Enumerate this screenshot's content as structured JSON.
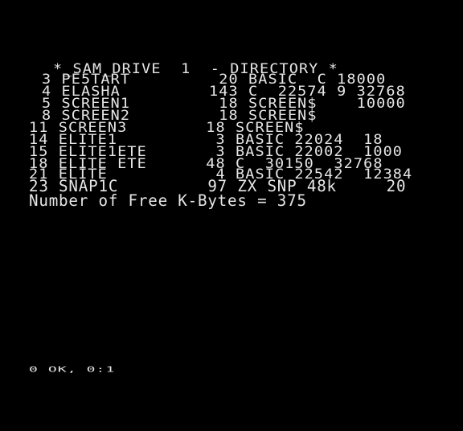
{
  "title": "*_SAM_DRIVE  1  - DIRECTORY *",
  "entries": [
    "3 PE5TART         20 BASIC  C 18000",
    "4 ELASHA         143 C  22574 9 32768",
    "5 SCREEN1         18 SCREEN$    10000",
    "8 SCREEN2         18 SCREEN$",
    "11 SCREEN3        18 SCREEN$",
    "14 ELITE1          3 BASIC 22024  18",
    "15 ELITE1ETE       3 BASIC 22002  1000",
    "18 ELITE ETE      48 C  30150  32768",
    "21 ELITE           4 BASIC 22542  12384",
    "23 SNAP1C         97 ZX SNP 48k     20"
  ],
  "footer": "Number of Free K-Bytes = 375",
  "status": "0 OK, 0:1"
}
